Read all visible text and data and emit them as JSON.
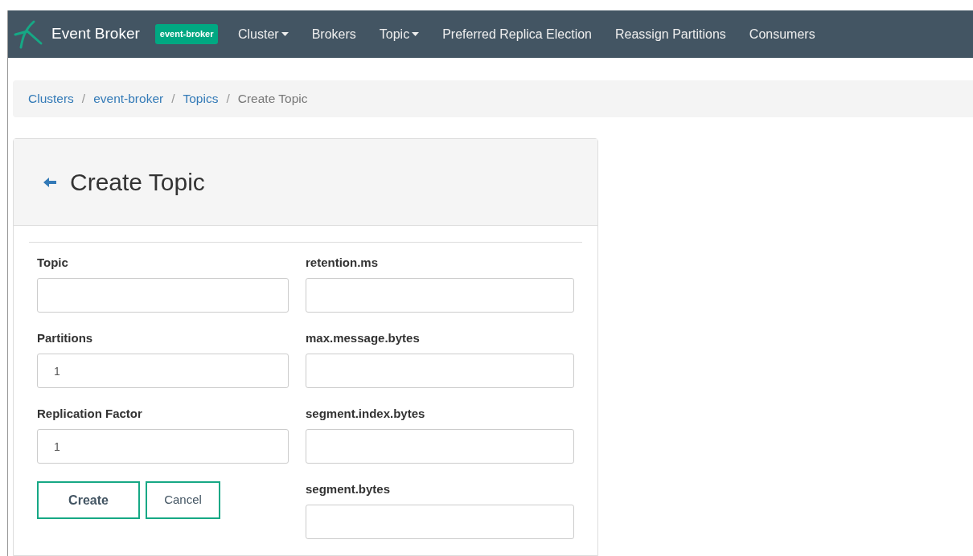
{
  "navbar": {
    "brand": "Event Broker",
    "cluster_badge": "event-broker",
    "items": [
      {
        "label": "Cluster",
        "kind": "dropdown"
      },
      {
        "label": "Brokers",
        "kind": "link"
      },
      {
        "label": "Topic",
        "kind": "dropdown"
      },
      {
        "label": "Preferred Replica Election",
        "kind": "link"
      },
      {
        "label": "Reassign Partitions",
        "kind": "link"
      },
      {
        "label": "Consumers",
        "kind": "link"
      }
    ]
  },
  "breadcrumb": [
    {
      "label": "Clusters",
      "kind": "link"
    },
    {
      "label": "/",
      "kind": "separator"
    },
    {
      "label": "event-broker",
      "kind": "link"
    },
    {
      "label": "/",
      "kind": "separator"
    },
    {
      "label": "Topics",
      "kind": "link"
    },
    {
      "label": "/",
      "kind": "separator"
    },
    {
      "label": "Create Topic",
      "kind": "current"
    }
  ],
  "panel": {
    "title": "Create Topic",
    "left_fields": [
      {
        "label": "Topic"
      },
      {
        "label": "Partitions",
        "value": "1"
      },
      {
        "label": "Replication Factor",
        "value": "1"
      }
    ],
    "right_fields": [
      {
        "label": "retention.ms"
      },
      {
        "label": "max.message.bytes"
      },
      {
        "label": "segment.index.bytes"
      },
      {
        "label": "segment.bytes"
      }
    ],
    "buttons": [
      {
        "label": "Create",
        "kind": "primary"
      },
      {
        "label": "Cancel",
        "kind": "secondary"
      }
    ]
  }
}
